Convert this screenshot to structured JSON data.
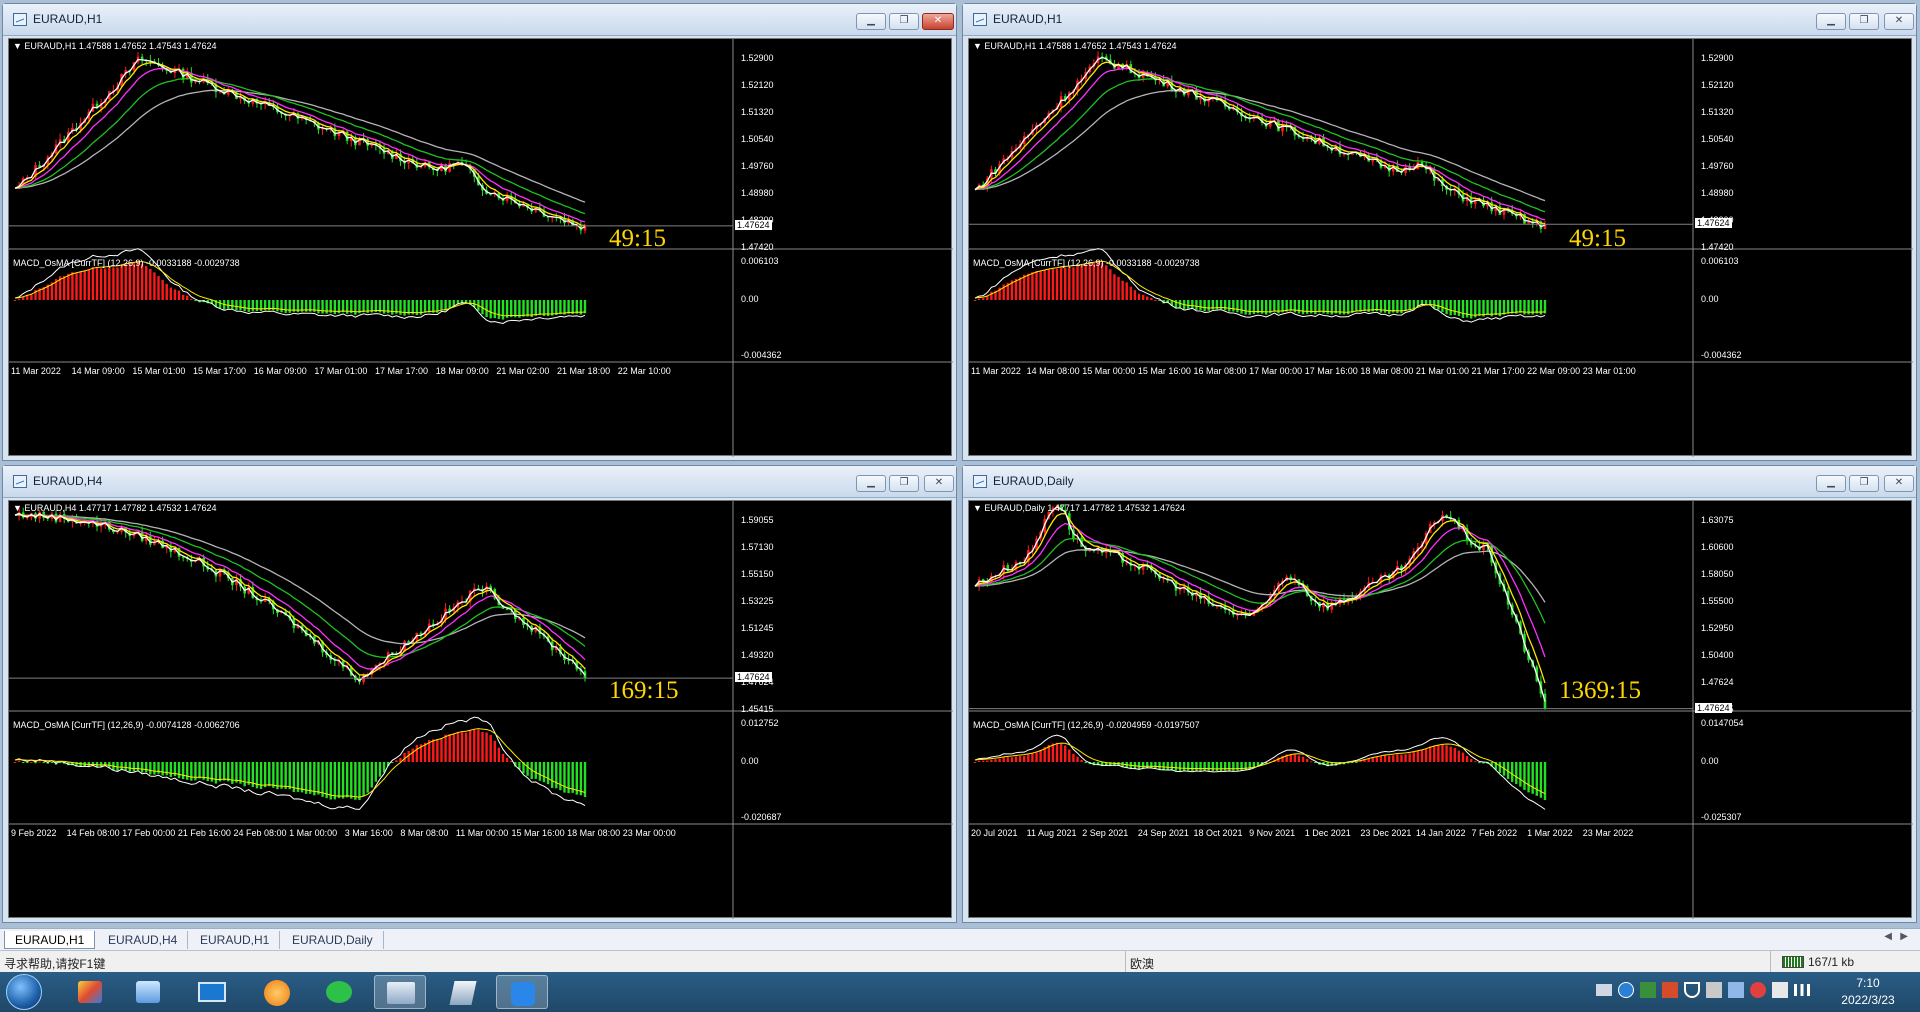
{
  "windows": [
    {
      "id": "w1",
      "title": "EURAUD,H1",
      "info": "EURAUD,H1  1.47588 1.47652 1.47543 1.47624",
      "yticks": [
        "1.52900",
        "1.52120",
        "1.51320",
        "1.50540",
        "1.49760",
        "1.48980",
        "1.48200",
        "1.47420"
      ],
      "last": "1.47624",
      "timer": "49:15",
      "macd": "MACD_OsMA [CurrTF] (12,26,9) -0.0033188 -0.0029738",
      "macdticks": [
        "0.006103",
        "0.00",
        "-0.004362"
      ],
      "xticks": [
        "11 Mar 2022",
        "14 Mar 09:00",
        "15 Mar 01:00",
        "15 Mar 17:00",
        "16 Mar 09:00",
        "17 Mar 01:00",
        "17 Mar 17:00",
        "18 Mar 09:00",
        "21 Mar 02:00",
        "21 Mar 18:00",
        "22 Mar 10:00"
      ]
    },
    {
      "id": "w2",
      "title": "EURAUD,H1",
      "info": "EURAUD,H1  1.47588 1.47652 1.47543 1.47624",
      "yticks": [
        "1.52900",
        "1.52120",
        "1.51320",
        "1.50540",
        "1.49760",
        "1.48980",
        "1.48200",
        "1.47420"
      ],
      "last": "1.47624",
      "timer": "49:15",
      "macd": "MACD_OsMA [CurrTF] (12,26,9) -0.0033188 -0.0029738",
      "macdticks": [
        "0.006103",
        "0.00",
        "-0.004362"
      ],
      "xticks": [
        "11 Mar 2022",
        "14 Mar 08:00",
        "15 Mar 00:00",
        "15 Mar 16:00",
        "16 Mar 08:00",
        "17 Mar 00:00",
        "17 Mar 16:00",
        "18 Mar 08:00",
        "21 Mar 01:00",
        "21 Mar 17:00",
        "22 Mar 09:00",
        "23 Mar 01:00"
      ]
    },
    {
      "id": "w3",
      "title": "EURAUD,H4",
      "info": "EURAUD,H4  1.47717 1.47782 1.47532 1.47624",
      "yticks": [
        "1.59055",
        "1.57130",
        "1.55150",
        "1.53225",
        "1.51245",
        "1.49320",
        "1.47624",
        "1.45415"
      ],
      "last": "1.47624",
      "timer": "169:15",
      "macd": "MACD_OsMA [CurrTF] (12,26,9) -0.0074128 -0.0062706",
      "macdticks": [
        "0.012752",
        "0.00",
        "-0.020687"
      ],
      "xticks": [
        "9 Feb 2022",
        "14 Feb 08:00",
        "17 Feb 00:00",
        "21 Feb 16:00",
        "24 Feb 08:00",
        "1 Mar 00:00",
        "3 Mar 16:00",
        "8 Mar 08:00",
        "11 Mar 00:00",
        "15 Mar 16:00",
        "18 Mar 08:00",
        "23 Mar 00:00"
      ]
    },
    {
      "id": "w4",
      "title": "EURAUD,Daily",
      "info": "EURAUD,Daily  1.47717 1.47782 1.47532 1.47624",
      "yticks": [
        "1.63075",
        "1.60600",
        "1.58050",
        "1.55500",
        "1.52950",
        "1.50400",
        "1.47624",
        "1.45375"
      ],
      "last": "1.47624",
      "timer": "1369:15",
      "macd": "MACD_OsMA [CurrTF] (12,26,9) -0.0204959 -0.0197507",
      "macdticks": [
        "0.0147054",
        "0.00",
        "-0.025307"
      ],
      "xticks": [
        "20 Jul 2021",
        "11 Aug 2021",
        "2 Sep 2021",
        "24 Sep 2021",
        "18 Oct 2021",
        "9 Nov 2021",
        "1 Dec 2021",
        "23 Dec 2021",
        "14 Jan 2022",
        "7 Feb 2022",
        "1 Mar 2022",
        "23 Mar 2022"
      ]
    }
  ],
  "tabs": [
    "EURAUD,H1",
    "EURAUD,H4",
    "EURAUD,H1",
    "EURAUD,Daily"
  ],
  "status": {
    "help": "寻求帮助,请按F1键",
    "profile": "欧澳",
    "traffic": "167/1 kb"
  },
  "taskbar": {
    "time": "7:10",
    "date": "2022/3/23"
  },
  "colors": {
    "bull": "#ff1a1a",
    "bear": "#23e023",
    "ma_fast": "#ffffff",
    "ma_yellow": "#ffe800",
    "ma_magenta": "#ff30ff",
    "ma_green": "#20c020",
    "ma_gray": "#b4b4b4"
  }
}
